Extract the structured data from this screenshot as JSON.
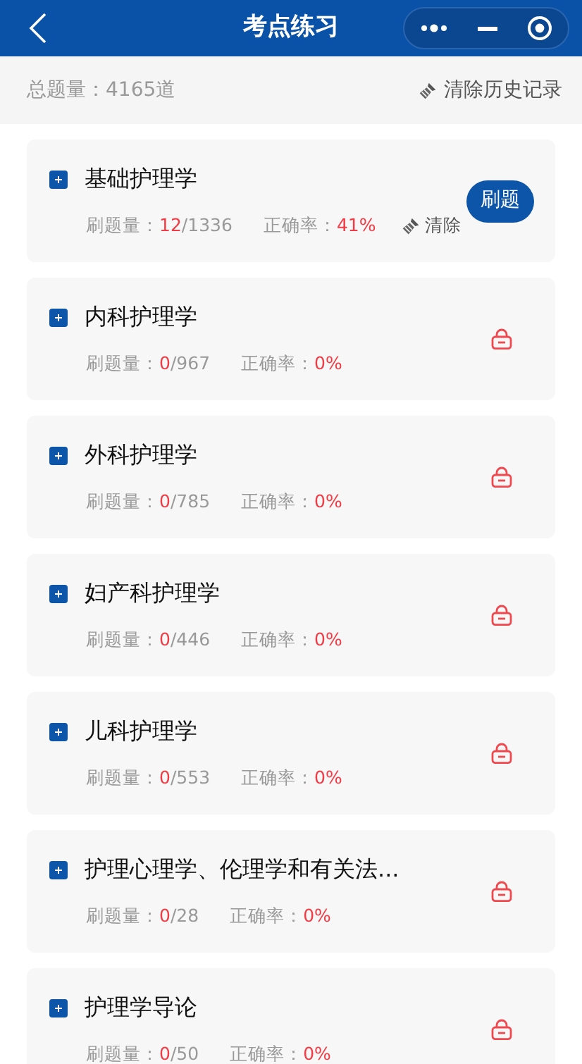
{
  "header": {
    "title": "考点练习"
  },
  "summary": {
    "total": "总题量：4165道",
    "clear_history": "清除历史记录"
  },
  "items": [
    {
      "kind": "unlocked",
      "title": "基础护理学",
      "count_label": "刷题量：",
      "done": "12",
      "total": "/1336",
      "accuracy_label": "正确率：",
      "accuracy": "41%",
      "clear": "清除",
      "action": "刷题"
    },
    {
      "kind": "locked",
      "title": "内科护理学",
      "count_label": "刷题量：",
      "done": "0",
      "total": "/967",
      "accuracy_label": "正确率：",
      "accuracy": "0%"
    },
    {
      "kind": "locked",
      "title": "外科护理学",
      "count_label": "刷题量：",
      "done": "0",
      "total": "/785",
      "accuracy_label": "正确率：",
      "accuracy": "0%"
    },
    {
      "kind": "locked",
      "title": "妇产科护理学",
      "count_label": "刷题量：",
      "done": "0",
      "total": "/446",
      "accuracy_label": "正确率：",
      "accuracy": "0%"
    },
    {
      "kind": "locked",
      "title": "儿科护理学",
      "count_label": "刷题量：",
      "done": "0",
      "total": "/553",
      "accuracy_label": "正确率：",
      "accuracy": "0%"
    },
    {
      "kind": "locked",
      "title": "护理心理学、伦理学和有关法...",
      "count_label": "刷题量：",
      "done": "0",
      "total": "/28",
      "accuracy_label": "正确率：",
      "accuracy": "0%"
    },
    {
      "kind": "locked",
      "title": "护理学导论",
      "count_label": "刷题量：",
      "done": "0",
      "total": "/50",
      "accuracy_label": "正确率：",
      "accuracy": "0%"
    }
  ]
}
